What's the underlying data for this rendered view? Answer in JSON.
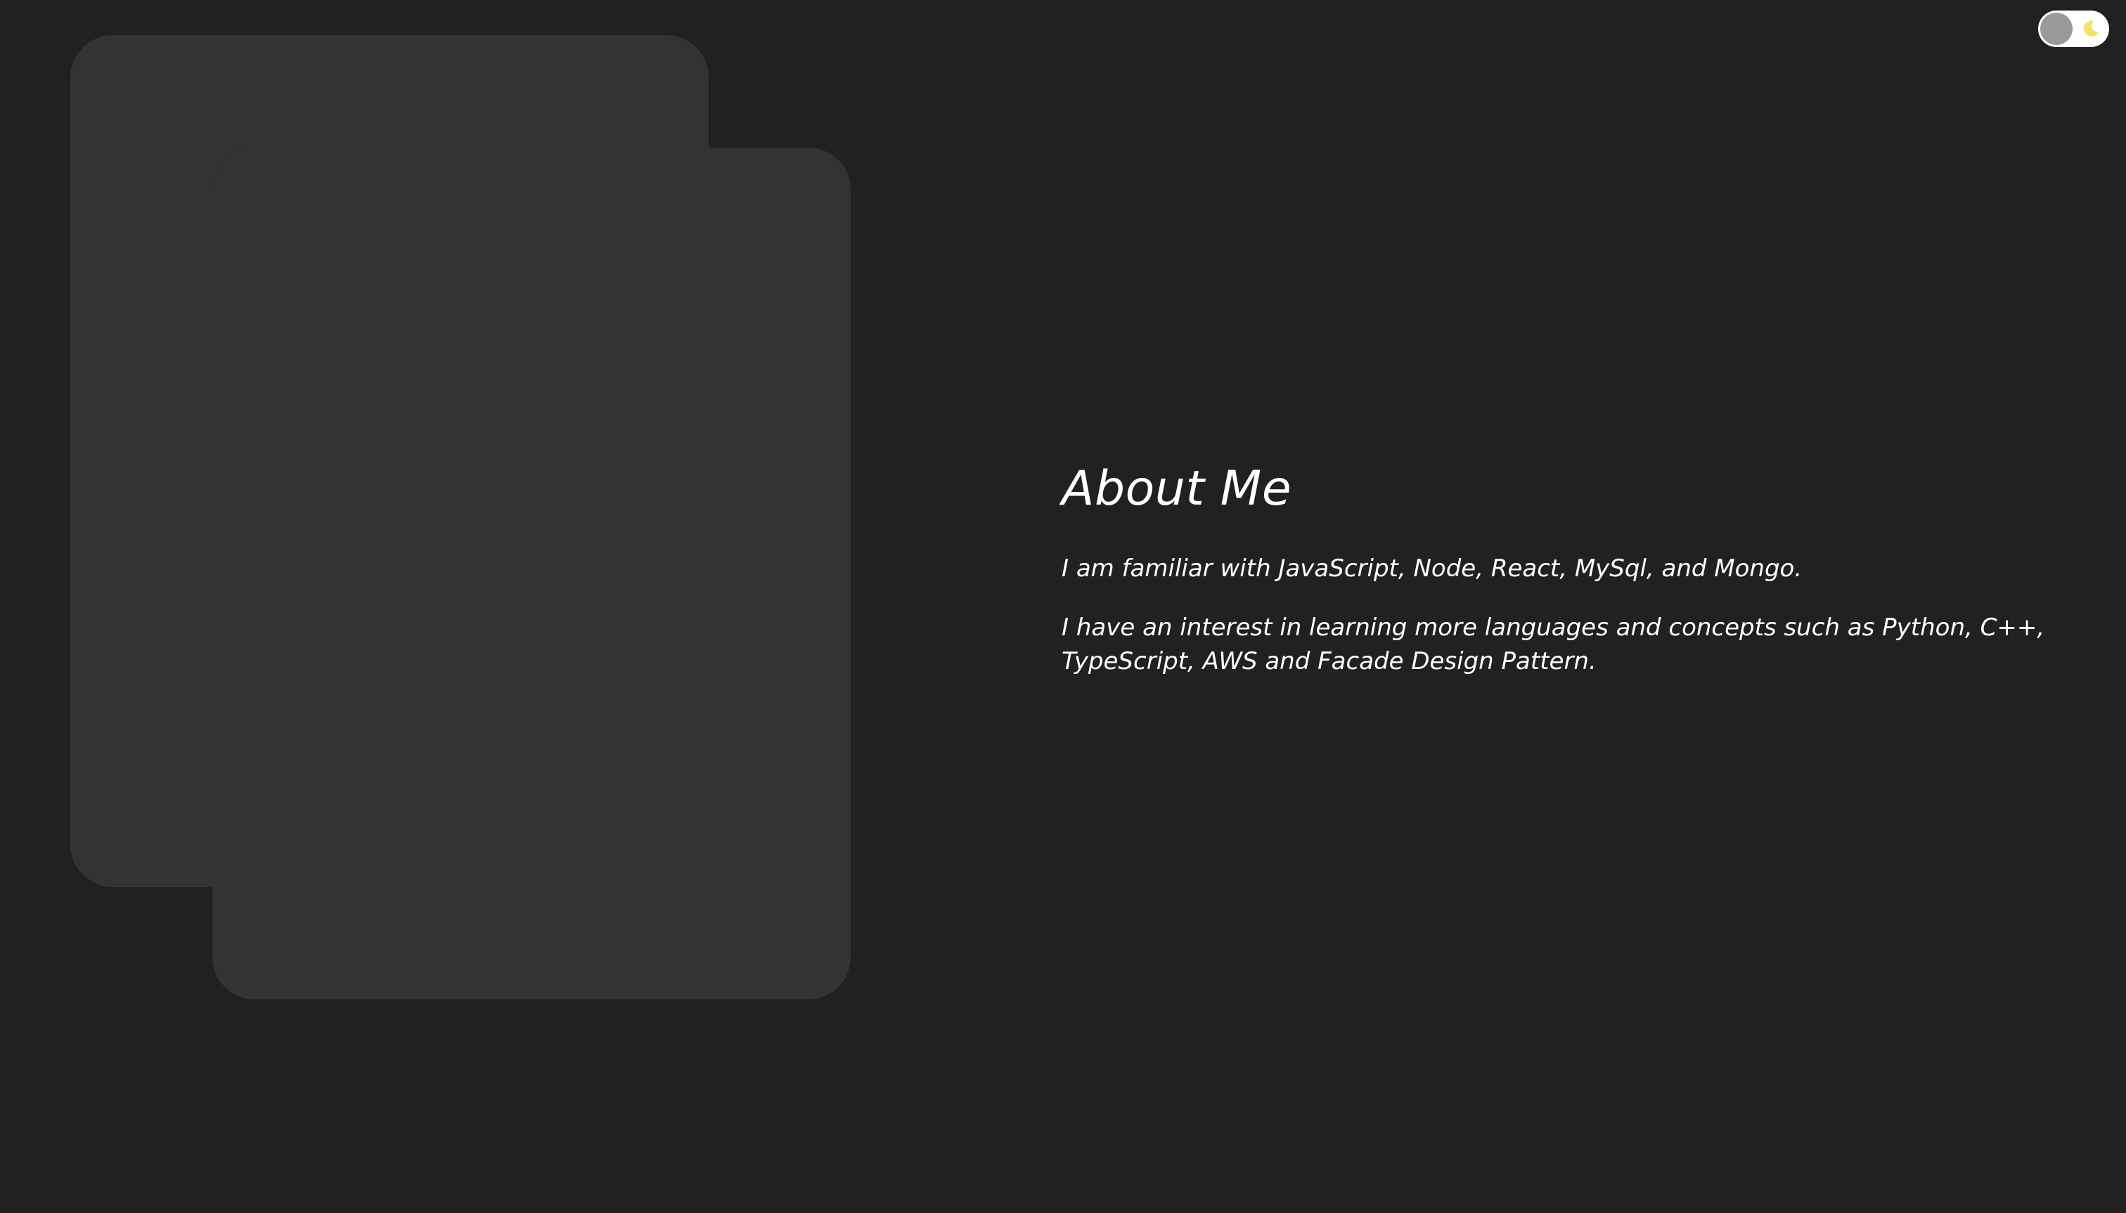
{
  "theme_toggle": {
    "state": "dark",
    "icon": "moon-icon",
    "track_color": "#ffffff",
    "knob_color": "#9a9a9a",
    "icon_color": "#f2e26b"
  },
  "about": {
    "title": "About Me",
    "paragraphs": [
      "I am familiar with JavaScript, Node, React, MySql, and Mongo.",
      "I have an interest in learning more languages and concepts such as Python, C++, TypeScript, AWS and Facade Design Pattern."
    ]
  },
  "colors": {
    "background": "#212121",
    "card": "#333333",
    "text": "#ffffff"
  }
}
